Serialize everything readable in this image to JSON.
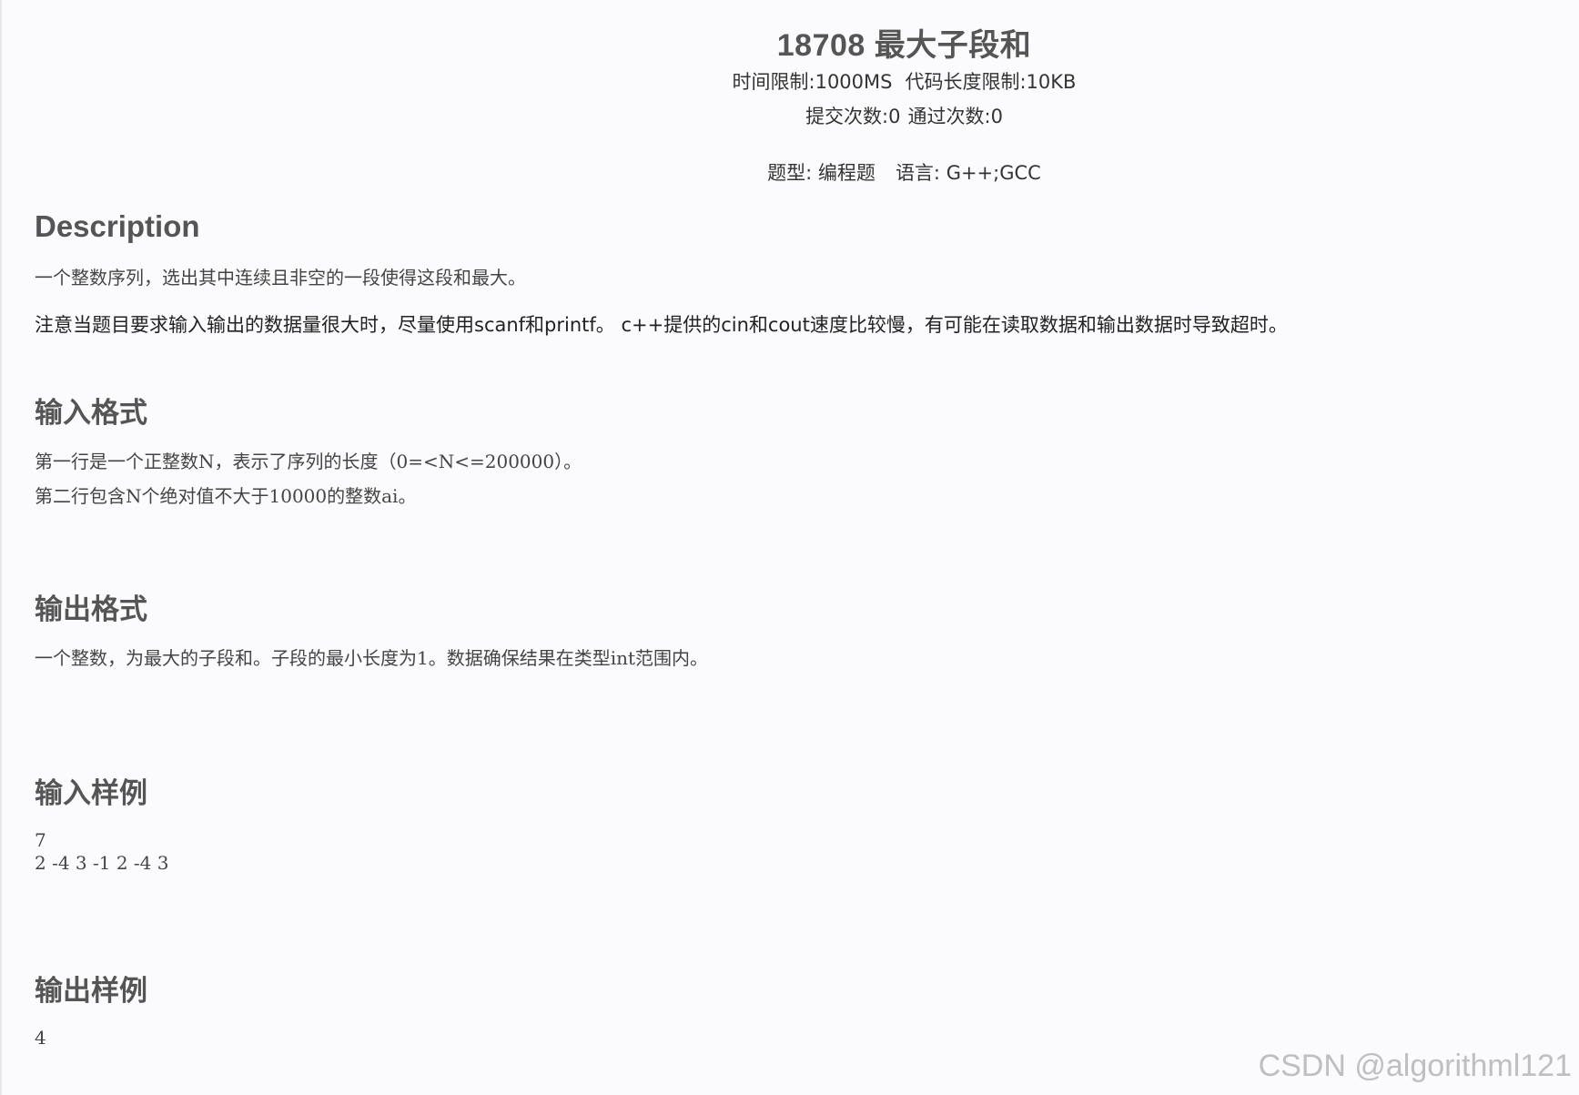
{
  "problem": {
    "title": "18708 最大子段和",
    "time_limit": "时间限制:1000MS",
    "code_limit": "代码长度限制:10KB",
    "submissions": "提交次数:0",
    "accepted": "通过次数:0",
    "type": "题型: 编程题",
    "language": "语言: G++;GCC"
  },
  "description": {
    "heading": "Description",
    "line1": "一个整数序列，选出其中连续且非空的一段使得这段和最大。",
    "line2": "注意当题目要求输入输出的数据量很大时，尽量使用scanf和printf。  c++提供的cin和cout速度比较慢，有可能在读取数据和输出数据时导致超时。"
  },
  "input_format": {
    "heading": "输入格式",
    "line1": "第一行是一个正整数N，表示了序列的长度（0=<N<=200000）。",
    "line2": "第二行包含N个绝对值不大于10000的整数ai。"
  },
  "output_format": {
    "heading": "输出格式",
    "line1": "一个整数，为最大的子段和。子段的最小长度为1。数据确保结果在类型int范围内。"
  },
  "sample_input": {
    "heading": "输入样例",
    "line1": "7",
    "line2": "2 -4 3 -1 2 -4 3"
  },
  "sample_output": {
    "heading": "输出样例",
    "line1": "4"
  },
  "watermark": "CSDN @algorithml121"
}
